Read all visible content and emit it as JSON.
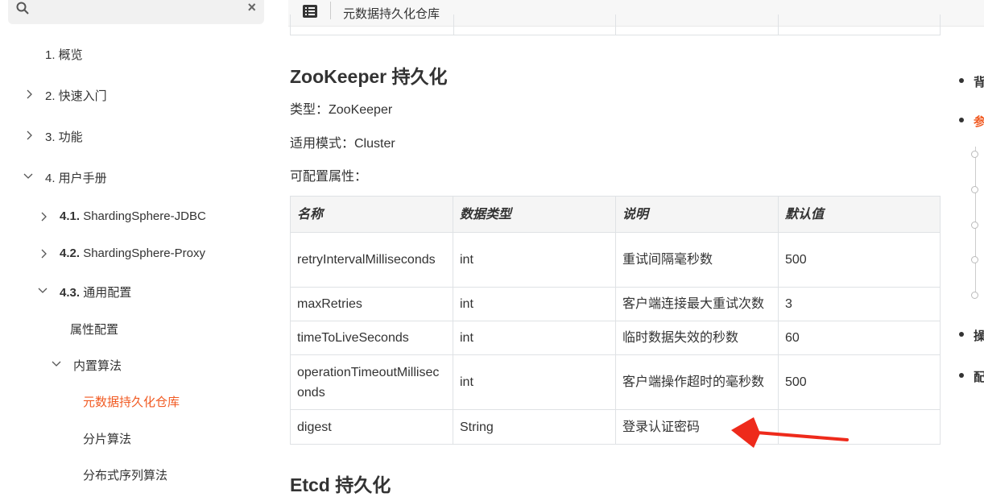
{
  "sidebar": {
    "items": [
      {
        "label": "1. 概览"
      },
      {
        "label": "2. 快速入门"
      },
      {
        "label": "3. 功能"
      },
      {
        "label": "4. 用户手册"
      },
      {
        "num": "4.1.",
        "label": "ShardingSphere-JDBC"
      },
      {
        "num": "4.2.",
        "label": "ShardingSphere-Proxy"
      },
      {
        "num": "4.3.",
        "label": "通用配置"
      },
      {
        "label": "属性配置"
      },
      {
        "label": "内置算法"
      },
      {
        "label": "元数据持久化仓库"
      },
      {
        "label": "分片算法"
      },
      {
        "label": "分布式序列算法"
      }
    ]
  },
  "topbar": {
    "title": "元数据持久化仓库"
  },
  "content": {
    "heading_zk": "ZooKeeper 持久化",
    "type_line": "类型：ZooKeeper",
    "mode_line": "适用模式：Cluster",
    "props_line": "可配置属性：",
    "table": {
      "headers": [
        "名称",
        "数据类型",
        "说明",
        "默认值"
      ],
      "rows": [
        [
          "retryIntervalMilliseconds",
          "int",
          "重试间隔毫秒数",
          "500"
        ],
        [
          "maxRetries",
          "int",
          "客户端连接最大重试次数",
          "3"
        ],
        [
          "timeToLiveSeconds",
          "int",
          "临时数据失效的秒数",
          "60"
        ],
        [
          "operationTimeoutMilliseconds",
          "int",
          "客户端操作超时的毫秒数",
          "500"
        ],
        [
          "digest",
          "String",
          "登录认证密码",
          ""
        ]
      ]
    },
    "heading_etcd": "Etcd 持久化"
  },
  "right_toc": {
    "items": [
      "背",
      "参",
      "操",
      "配"
    ],
    "active_color": "#f15a22"
  },
  "colors": {
    "accent": "#f15a22",
    "arrow": "#ee2a1b"
  }
}
